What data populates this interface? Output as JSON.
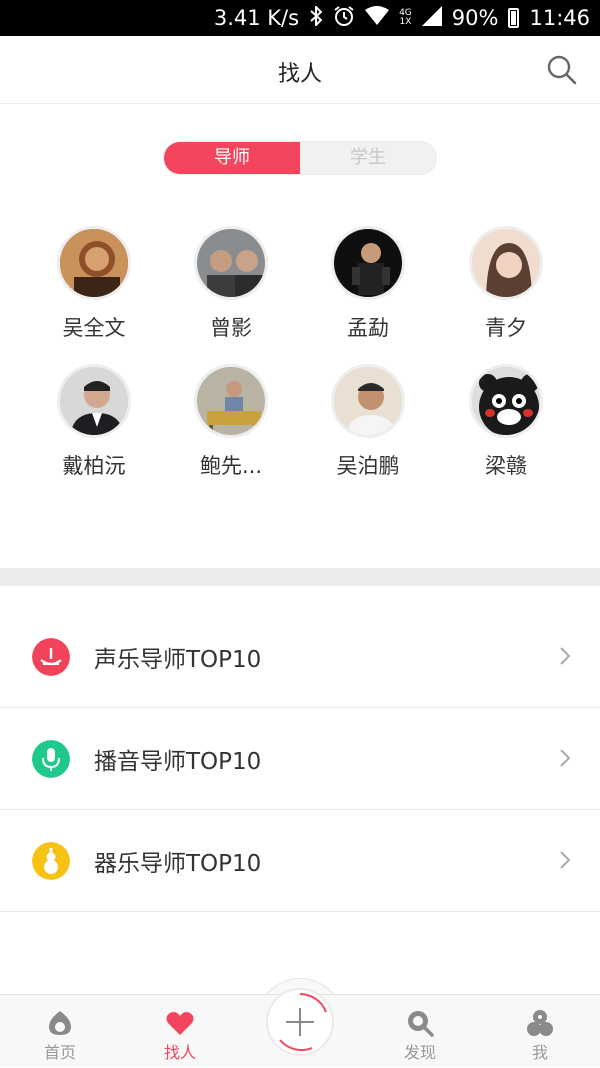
{
  "status_bar": {
    "speed": "3.41 K/s",
    "network_top": "4G",
    "network_bottom": "1X",
    "battery": "90%",
    "time": "11:46",
    "icons": [
      "bluetooth-icon",
      "alarm-icon",
      "wifi-icon",
      "signal-icon",
      "battery-icon"
    ]
  },
  "header": {
    "title": "找人",
    "search_icon": "search-icon"
  },
  "segment": {
    "tabs": [
      {
        "label": "导师",
        "active": true
      },
      {
        "label": "学生",
        "active": false
      }
    ]
  },
  "mentors": [
    {
      "name": "吴全文",
      "avatar_color": "#b5683a"
    },
    {
      "name": "曾影",
      "avatar_color": "#6b6f72"
    },
    {
      "name": "孟勐",
      "avatar_color": "#1a1a1a"
    },
    {
      "name": "青夕",
      "avatar_color": "#e8c4b0"
    },
    {
      "name": "戴柏沅",
      "avatar_color": "#cfcfcf"
    },
    {
      "name": "鲍先...",
      "avatar_color": "#a89b7e"
    },
    {
      "name": "吴泊鹏",
      "avatar_color": "#e2d7c8"
    },
    {
      "name": "梁赣",
      "avatar_color": "#222222"
    }
  ],
  "top_lists": [
    {
      "label": "声乐导师TOP10",
      "icon": "vocal-icon",
      "color": "#f1445b"
    },
    {
      "label": "播音导师TOP10",
      "icon": "microphone-icon",
      "color": "#1fc98b"
    },
    {
      "label": "器乐导师TOP10",
      "icon": "instrument-icon",
      "color": "#f6c315"
    }
  ],
  "bottom_nav": {
    "items": [
      {
        "label": "首页",
        "icon": "home-icon",
        "active": false
      },
      {
        "label": "找人",
        "icon": "heart-icon",
        "active": true
      },
      {
        "label": "发现",
        "icon": "discover-icon",
        "active": false
      },
      {
        "label": "我",
        "icon": "profile-icon",
        "active": false
      }
    ],
    "center_icon": "plus-icon"
  },
  "colors": {
    "accent": "#f4455e",
    "inactive_text": "#999999"
  }
}
